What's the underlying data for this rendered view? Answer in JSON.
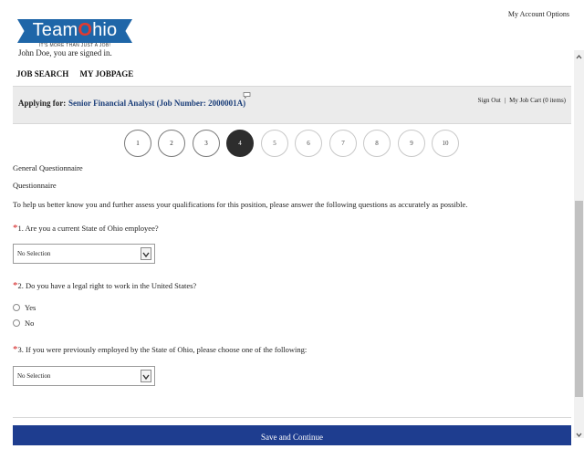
{
  "logo": {
    "prefix": "Team",
    "o": "O",
    "suffix": "hio",
    "tagline": "IT'S MORE THAN JUST A JOB!"
  },
  "header": {
    "account_options": "My Account Options",
    "signed_in": "John Doe, you are signed in."
  },
  "nav": {
    "items": [
      "JOB SEARCH",
      "MY JOBPAGE"
    ]
  },
  "apply": {
    "label": "Applying for:",
    "job": "Senior Financial Analyst (Job Number: 2000001A)",
    "sign_out": "Sign Out",
    "sep": "|",
    "cart": "My Job Cart (0 items)"
  },
  "steps": {
    "labels": [
      "1",
      "2",
      "3",
      "4",
      "5",
      "6",
      "7",
      "8",
      "9",
      "10"
    ],
    "current": "4"
  },
  "page": {
    "section": "General Questionnaire",
    "subsection": "Questionnaire",
    "intro": "To help us better know you and further assess your qualifications for this position, please answer the following questions as accurately as possible."
  },
  "questions": {
    "required_mark": "*",
    "q1": {
      "text": "1.  Are you a current State of Ohio employee?",
      "value": "No Selection"
    },
    "q2": {
      "text": "2.  Do you have a legal right to work in the United States?",
      "options": [
        "Yes",
        "No"
      ]
    },
    "q3": {
      "text": "3.  If you were previously employed by the State of Ohio, please choose one of the following:",
      "value": "No Selection"
    }
  },
  "footer": {
    "save_label": "Save and Continue"
  },
  "colors": {
    "brand_blue": "#1f66a8",
    "brand_red": "#e23a2f",
    "required": "#d01818",
    "job_link": "#1c3f7a",
    "button": "#1e3d8f"
  }
}
